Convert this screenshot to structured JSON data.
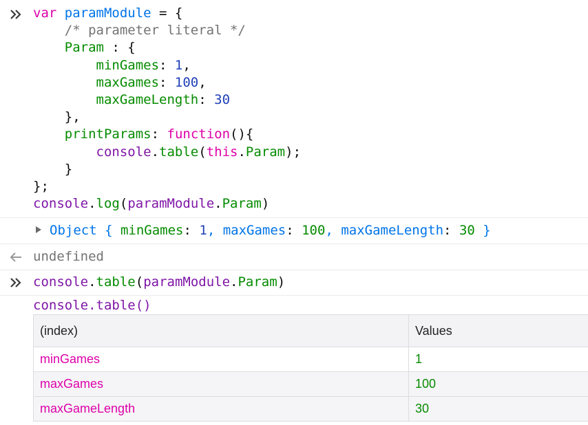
{
  "input1": {
    "lines": [
      [
        {
          "t": "var ",
          "c": "kw"
        },
        {
          "t": "paramModule",
          "c": "fn"
        },
        {
          "t": " = {",
          "c": "ink"
        }
      ],
      [
        {
          "t": "    ",
          "c": "ink"
        },
        {
          "t": "/* parameter literal */",
          "c": "cmt"
        }
      ],
      [
        {
          "t": "    ",
          "c": "ink"
        },
        {
          "t": "Param",
          "c": "prop"
        },
        {
          "t": " : {",
          "c": "ink"
        }
      ],
      [
        {
          "t": "        ",
          "c": "ink"
        },
        {
          "t": "minGames",
          "c": "prop"
        },
        {
          "t": ": ",
          "c": "ink"
        },
        {
          "t": "1",
          "c": "num"
        },
        {
          "t": ",",
          "c": "ink"
        }
      ],
      [
        {
          "t": "        ",
          "c": "ink"
        },
        {
          "t": "maxGames",
          "c": "prop"
        },
        {
          "t": ": ",
          "c": "ink"
        },
        {
          "t": "100",
          "c": "num"
        },
        {
          "t": ",",
          "c": "ink"
        }
      ],
      [
        {
          "t": "        ",
          "c": "ink"
        },
        {
          "t": "maxGameLength",
          "c": "prop"
        },
        {
          "t": ": ",
          "c": "ink"
        },
        {
          "t": "30",
          "c": "num"
        }
      ],
      [
        {
          "t": "    },",
          "c": "ink"
        }
      ],
      [
        {
          "t": "    ",
          "c": "ink"
        },
        {
          "t": "printParams",
          "c": "prop"
        },
        {
          "t": ": ",
          "c": "ink"
        },
        {
          "t": "function",
          "c": "kw"
        },
        {
          "t": "(){",
          "c": "ink"
        }
      ],
      [
        {
          "t": "        ",
          "c": "ink"
        },
        {
          "t": "console",
          "c": "obj"
        },
        {
          "t": ".",
          "c": "ink"
        },
        {
          "t": "table",
          "c": "prop"
        },
        {
          "t": "(",
          "c": "ink"
        },
        {
          "t": "this",
          "c": "kw"
        },
        {
          "t": ".",
          "c": "ink"
        },
        {
          "t": "Param",
          "c": "prop"
        },
        {
          "t": ");",
          "c": "ink"
        }
      ],
      [
        {
          "t": "    }",
          "c": "ink"
        }
      ],
      [
        {
          "t": "};",
          "c": "ink"
        }
      ],
      [
        {
          "t": "console",
          "c": "obj"
        },
        {
          "t": ".",
          "c": "ink"
        },
        {
          "t": "log",
          "c": "prop"
        },
        {
          "t": "(",
          "c": "ink"
        },
        {
          "t": "paramModule",
          "c": "obj"
        },
        {
          "t": ".",
          "c": "ink"
        },
        {
          "t": "Param",
          "c": "prop"
        },
        {
          "t": ")",
          "c": "ink"
        }
      ]
    ]
  },
  "output1": {
    "parts": [
      {
        "t": "Object { ",
        "c": "fn"
      },
      {
        "t": "minGames",
        "c": "prop"
      },
      {
        "t": ": ",
        "c": "ink"
      },
      {
        "t": "1",
        "c": "num"
      },
      {
        "t": ", ",
        "c": "fn"
      },
      {
        "t": "maxGames",
        "c": "fn"
      },
      {
        "t": ": ",
        "c": "ink"
      },
      {
        "t": "100",
        "c": "prop"
      },
      {
        "t": ", ",
        "c": "fn"
      },
      {
        "t": "maxGameLength",
        "c": "fn"
      },
      {
        "t": ": ",
        "c": "ink"
      },
      {
        "t": "30",
        "c": "prop"
      },
      {
        "t": " }",
        "c": "fn"
      }
    ]
  },
  "result1": {
    "text": "undefined"
  },
  "input2": {
    "parts": [
      {
        "t": "console",
        "c": "obj"
      },
      {
        "t": ".",
        "c": "ink"
      },
      {
        "t": "table",
        "c": "prop"
      },
      {
        "t": "(",
        "c": "ink"
      },
      {
        "t": "paramModule",
        "c": "obj"
      },
      {
        "t": ".",
        "c": "ink"
      },
      {
        "t": "Param",
        "c": "prop"
      },
      {
        "t": ")",
        "c": "ink"
      }
    ]
  },
  "table_output": {
    "title": "console.table()",
    "headers": [
      "(index)",
      "Values"
    ],
    "rows": [
      {
        "key": "minGames",
        "value": "1"
      },
      {
        "key": "maxGames",
        "value": "100"
      },
      {
        "key": "maxGameLength",
        "value": "30"
      }
    ]
  },
  "colors": {
    "keyword": "#dd00a9",
    "function_name": "#0074e8",
    "property": "#058b00",
    "number": "#1f3fb8",
    "comment": "#737373",
    "object": "#7f16a6"
  },
  "icons": {
    "prompt": "chevrons-right-icon",
    "return": "arrow-left-icon",
    "expand": "triangle-right-icon"
  }
}
